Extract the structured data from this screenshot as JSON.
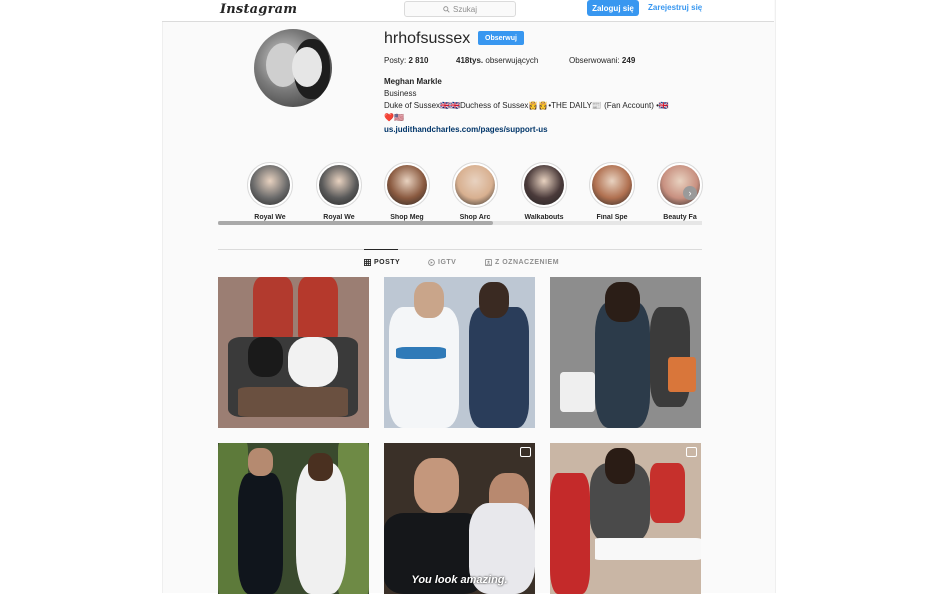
{
  "header": {
    "logo": "Instagram",
    "search_placeholder": "Szukaj",
    "login_label": "Zaloguj się",
    "register_label": "Zarejestruj się"
  },
  "profile": {
    "username": "hrhofsussex",
    "follow_label": "Obserwuj",
    "posts_label": "Posty:",
    "posts_value": "2 810",
    "followers_value": "418tys.",
    "followers_label": "obserwujących",
    "following_label": "Obserwowani:",
    "following_value": "249",
    "full_name": "Meghan Markle",
    "category": "Business",
    "bio_line1": "Duke of Sussex🇬🇧🇬🇧Duchess of Sussex👸👸•THE DAILY📰 (Fan Account) •🇬🇧",
    "bio_line2": "❤️🇺🇸",
    "website": "us.judithandcharles.com/pages/support-us"
  },
  "highlights": [
    {
      "label": "Royal We",
      "color": "#6b6b6b"
    },
    {
      "label": "Royal We",
      "color": "#5a5a5a"
    },
    {
      "label": "Shop Meg",
      "color": "#8a5a40"
    },
    {
      "label": "Shop Arc",
      "color": "#d8b090"
    },
    {
      "label": "Walkabouts",
      "color": "#4a3a3a"
    },
    {
      "label": "Final Spe",
      "color": "#b07050"
    },
    {
      "label": "Beauty Fa",
      "color": "#c89080"
    }
  ],
  "tabs": [
    {
      "label": "POSTY",
      "icon": "grid-icon",
      "active": true
    },
    {
      "label": "IGTV",
      "icon": "igtv-icon",
      "active": false
    },
    {
      "label": "Z OZNACZENIEM",
      "icon": "tagged-icon",
      "active": false
    }
  ],
  "posts": [
    {
      "subject": "royal-carriage",
      "bg": "#9b7e73"
    },
    {
      "subject": "polo-event",
      "bg": "#bdc7d3"
    },
    {
      "subject": "walkabout",
      "bg": "#8d8d8d"
    },
    {
      "subject": "wedding-exit",
      "bg": "#3a4a2e"
    },
    {
      "subject": "wedding-video",
      "bg": "#3a3028",
      "caption": "You look amazing."
    },
    {
      "subject": "cafe-visit",
      "bg": "#c9b6a5"
    }
  ]
}
